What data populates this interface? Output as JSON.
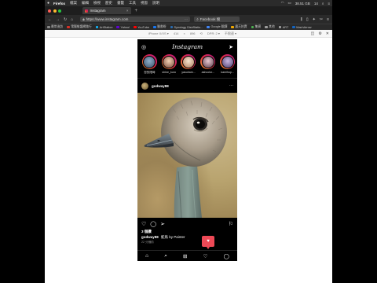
{
  "menubar": {
    "apple": "",
    "app_name": "Firefox",
    "items": [
      "檔案",
      "編輯",
      "檢視",
      "歷史",
      "書籤",
      "工具",
      "視窗",
      "說明"
    ],
    "status_text": "38.51 GB",
    "time_text": "14"
  },
  "tab": {
    "title": "Instagram",
    "close": "×",
    "new_tab": "+"
  },
  "navbar": {
    "url": "https://www.instagram.com",
    "search_placeholder": "Facebook 搜"
  },
  "bookmarks": [
    {
      "label": "最常造訪",
      "color": "#888888"
    },
    {
      "label": "電腦維護網路行",
      "color": "#d93025"
    },
    {
      "label": "ArtStation",
      "color": "#13aff0"
    },
    {
      "label": "Yahoo!",
      "color": "#6001d2"
    },
    {
      "label": "YouTube",
      "color": "#ff0000"
    },
    {
      "label": "臉書粉",
      "color": "#1877f2"
    },
    {
      "label": "Synology DiskStatio...",
      "color": "#2a6cb0"
    },
    {
      "label": "Google 翻譯",
      "color": "#4285f4"
    },
    {
      "label": "露天拍賣",
      "color": "#f2a900"
    },
    {
      "label": "集資",
      "color": "#4caf50"
    },
    {
      "label": "其他",
      "color": "#9e9e9e"
    },
    {
      "label": "ART",
      "color": "#9e9e9e"
    },
    {
      "label": "MachArrow",
      "color": "#1565c0"
    }
  ],
  "rdm": {
    "device": "iPhone X/XS ▾",
    "width": "414",
    "x": "×",
    "height": "896",
    "dpr": "DPR: 2 ▾",
    "throttle": "不限速 ▾"
  },
  "instagram": {
    "logo": "Instagram",
    "stories": [
      "您的限時",
      "shine_kuro",
      "yasuiram...",
      "ashcolor...",
      "kamihop..."
    ],
    "post": {
      "username": "godway88",
      "likes": "3 個讚",
      "caption_user": "godway88",
      "caption_text": "鴕鳥 by Painter",
      "time_ago": "22 分鐘前",
      "notification_count": "1"
    }
  },
  "colors": {
    "story_ring": "#dc2743",
    "notification": "#ed4956",
    "ig_bg": "#000000",
    "browser_chrome": "#2a2a2a"
  },
  "icons": [
    "camera-icon",
    "send-icon",
    "more-icon",
    "heart-icon",
    "comment-icon",
    "share-icon",
    "bookmark-icon",
    "home-icon",
    "search-icon",
    "add-post-icon",
    "activity-icon",
    "profile-icon"
  ]
}
